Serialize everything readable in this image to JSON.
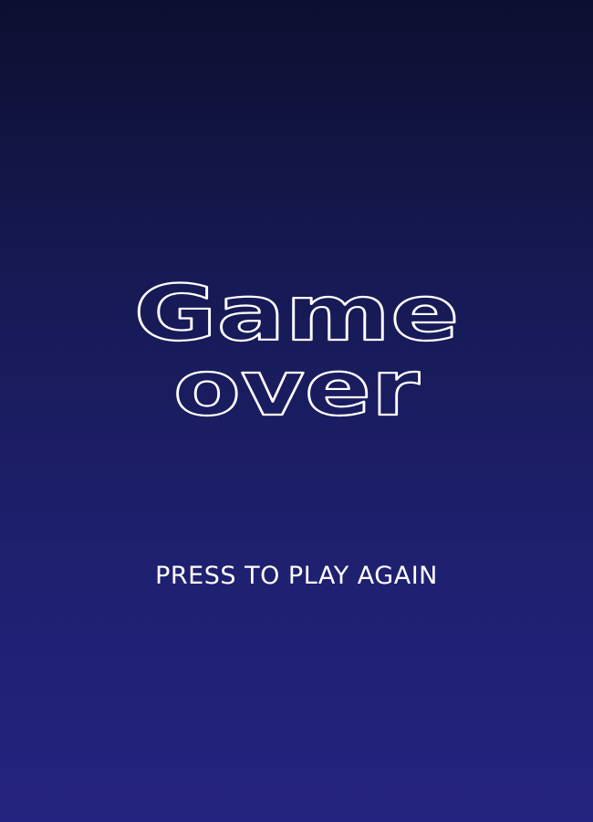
{
  "title": {
    "line1": "Game",
    "line2": "over"
  },
  "prompt": {
    "label": "PRESS TO PLAY AGAIN"
  },
  "colors": {
    "background_top": "#0d0f30",
    "background_bottom": "#24237f",
    "text": "#ffffff"
  }
}
